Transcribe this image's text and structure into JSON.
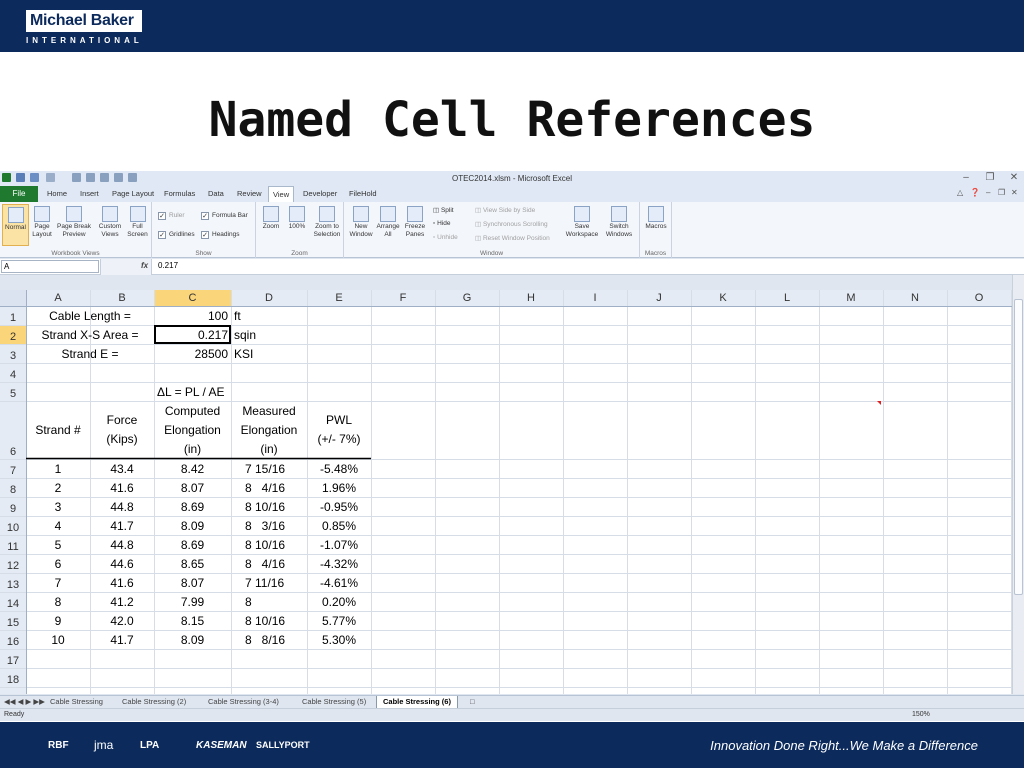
{
  "slide": {
    "title": "Named Cell References",
    "logo": {
      "name": "Michael Baker",
      "sub": "INTERNATIONAL"
    },
    "tagline": "Innovation Done Right...We Make a Difference",
    "partners": [
      "RBF",
      "jma",
      "LPA",
      "KASEMAN",
      "SALLYPORT"
    ]
  },
  "window": {
    "title": "OTEC2014.xlsm - Microsoft Excel"
  },
  "menu": {
    "file": "File",
    "tabs": [
      "Home",
      "Insert",
      "Page Layout",
      "Formulas",
      "Data",
      "Review",
      "View",
      "Developer",
      "FileHold"
    ],
    "active": "View"
  },
  "ribbon": {
    "workbook_views": {
      "label": "Workbook Views",
      "buttons": [
        "Normal",
        "Page Layout",
        "Page Break Preview",
        "Custom Views",
        "Full Screen"
      ]
    },
    "show": {
      "label": "Show",
      "ruler": "Ruler",
      "formula_bar": "Formula Bar",
      "gridlines": "Gridlines",
      "headings": "Headings"
    },
    "zoom": {
      "label": "Zoom",
      "buttons": [
        "Zoom",
        "100%",
        "Zoom to Selection"
      ]
    },
    "window": {
      "label": "Window",
      "buttons": [
        "New Window",
        "Arrange All",
        "Freeze Panes"
      ],
      "split": "Split",
      "hide": "Hide",
      "unhide": "Unhide",
      "side_by_side": "View Side by Side",
      "sync_scroll": "Synchronous Scrolling",
      "reset_pos": "Reset Window Position",
      "save_ws": "Save Workspace",
      "switch": "Switch Windows"
    },
    "macros": {
      "label": "Macros",
      "button": "Macros"
    }
  },
  "formula_bar": {
    "name_box": "A",
    "fx": "fx",
    "formula": "0.217"
  },
  "sheet": {
    "columns": [
      "A",
      "B",
      "C",
      "D",
      "E",
      "F",
      "G",
      "H",
      "I",
      "J",
      "K",
      "L",
      "M",
      "N",
      "O"
    ],
    "rows": [
      "1",
      "2",
      "3",
      "4",
      "5",
      "6",
      "7",
      "8",
      "9",
      "10",
      "11",
      "12",
      "13",
      "14",
      "15",
      "16",
      "17",
      "18"
    ],
    "selected_col": "C",
    "selected_row": "2",
    "cells": {
      "A1": "Cable Length =",
      "C1": "100",
      "D1": "ft",
      "A2": "Strand X-S Area =",
      "C2": "0.217",
      "D2": "sqin",
      "A3": "Strand E =",
      "C3": "28500",
      "D3": "KSI",
      "C5": "ΔL = PL / AE",
      "A6": "Strand #",
      "B6": [
        "Force",
        "(Kips)"
      ],
      "C6": [
        "Computed",
        "Elongation",
        "(in)"
      ],
      "D6": [
        "Measured",
        "Elongation",
        "(in)"
      ],
      "E6": [
        "PWL",
        "(+/- 7%)"
      ]
    },
    "table": [
      [
        "1",
        "43.4",
        "8.42",
        "7 15/16",
        "-5.48%"
      ],
      [
        "2",
        "41.6",
        "8.07",
        "8   4/16",
        "1.96%"
      ],
      [
        "3",
        "44.8",
        "8.69",
        "8 10/16",
        "-0.95%"
      ],
      [
        "4",
        "41.7",
        "8.09",
        "8   3/16",
        "0.85%"
      ],
      [
        "5",
        "44.8",
        "8.69",
        "8 10/16",
        "-1.07%"
      ],
      [
        "6",
        "44.6",
        "8.65",
        "8   4/16",
        "-4.32%"
      ],
      [
        "7",
        "41.6",
        "8.07",
        "7 11/16",
        "-4.61%"
      ],
      [
        "8",
        "41.2",
        "7.99",
        "8",
        "0.20%"
      ],
      [
        "9",
        "42.0",
        "8.15",
        "8 10/16",
        "5.77%"
      ],
      [
        "10",
        "41.7",
        "8.09",
        "8   8/16",
        "5.30%"
      ]
    ]
  },
  "sheet_tabs": [
    "Cable Stressing",
    "Cable Stressing (2)",
    "Cable Stressing (3-4)",
    "Cable Stressing (5)",
    "Cable Stressing (6)"
  ],
  "active_sheet_tab": "Cable Stressing (6)",
  "status": {
    "text": "Ready",
    "zoom": "150%"
  },
  "colors": {
    "banner": "#0c2a5c",
    "file_tab": "#1f7a30",
    "selection": "#fbd57a"
  }
}
